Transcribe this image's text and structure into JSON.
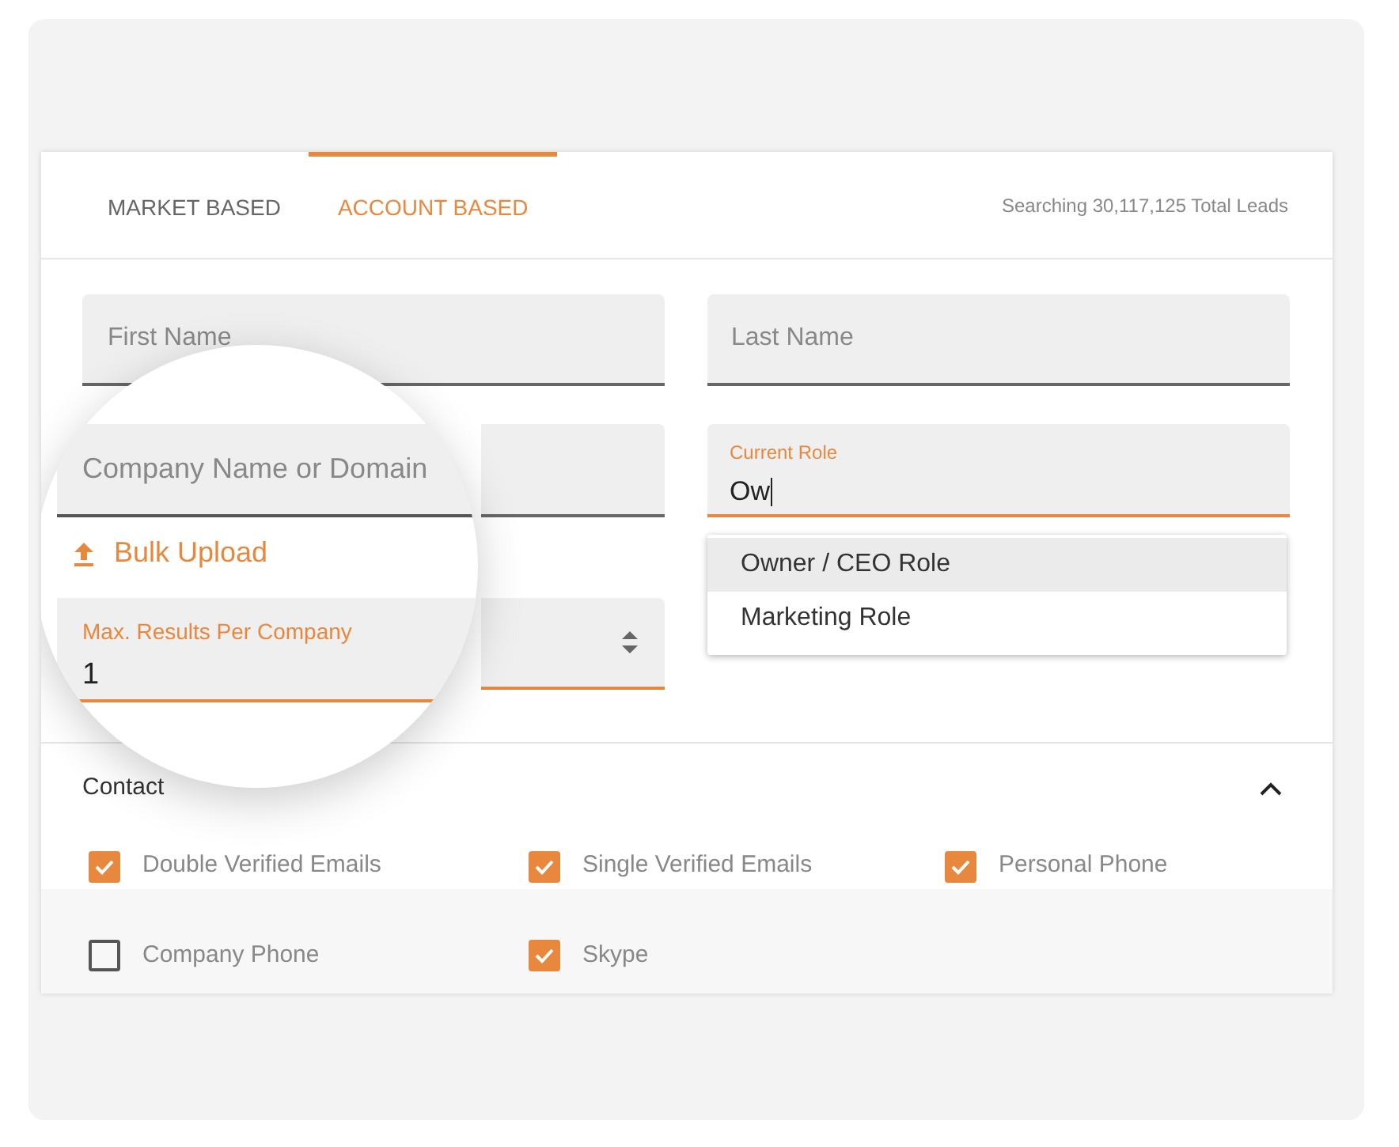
{
  "tabs": [
    {
      "label": "MARKET BASED",
      "selected": false
    },
    {
      "label": "ACCOUNT BASED",
      "selected": true
    }
  ],
  "lead_count": "Searching 30,117,125 Total Leads",
  "fields": {
    "first_name": {
      "placeholder": "First Name"
    },
    "last_name": {
      "placeholder": "Last Name"
    },
    "company": {
      "placeholder": "Company Name or Domain"
    },
    "current_role": {
      "label": "Current Role",
      "value": "Ow"
    },
    "max_results": {
      "label": "Max. Results Per Company",
      "value": "1"
    }
  },
  "bulk_upload": "Bulk Upload",
  "role_suggestions": [
    {
      "label": "Owner / CEO Role",
      "selected": true
    },
    {
      "label": "Marketing Role",
      "selected": false
    }
  ],
  "contact_section": {
    "title": "Contact",
    "expanded": true,
    "options": [
      {
        "label": "Double Verified Emails",
        "checked": true
      },
      {
        "label": "Single Verified Emails",
        "checked": true
      },
      {
        "label": "Personal Phone",
        "checked": true
      },
      {
        "label": "Company Phone",
        "checked": false
      },
      {
        "label": "Skype",
        "checked": true
      }
    ]
  }
}
